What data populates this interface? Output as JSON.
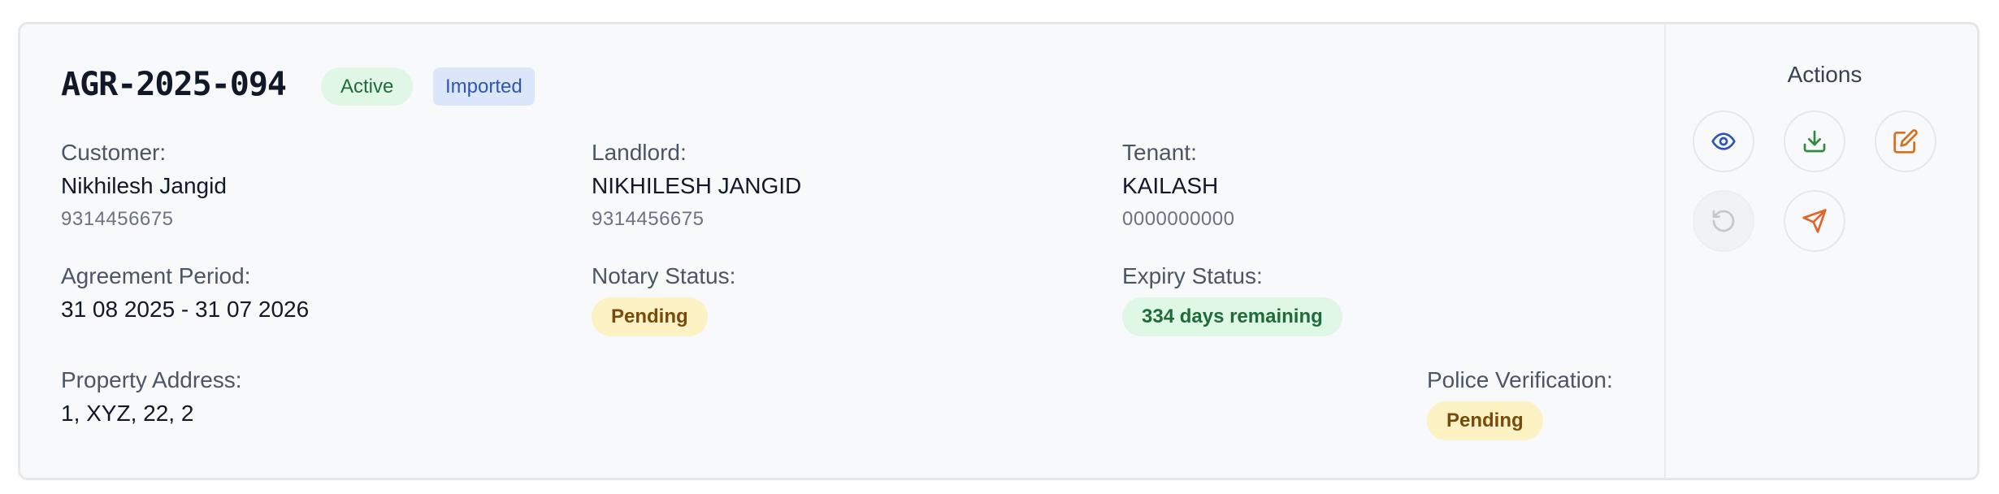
{
  "agreement": {
    "id": "AGR-2025-094",
    "status_badge": "Active",
    "source_badge": "Imported"
  },
  "customer": {
    "label": "Customer:",
    "name": "Nikhilesh Jangid",
    "phone": "9314456675"
  },
  "landlord": {
    "label": "Landlord:",
    "name": "NIKHILESH JANGID",
    "phone": "9314456675"
  },
  "tenant": {
    "label": "Tenant:",
    "name": "KAILASH",
    "phone": "0000000000"
  },
  "period": {
    "label": "Agreement Period:",
    "value": "31 08 2025 - 31 07 2026"
  },
  "notary": {
    "label": "Notary Status:",
    "value": "Pending"
  },
  "expiry": {
    "label": "Expiry Status:",
    "value": "334 days remaining"
  },
  "address": {
    "label": "Property Address:",
    "value": "1, XYZ, 22, 2"
  },
  "police": {
    "label": "Police Verification:",
    "value": "Pending"
  },
  "actions": {
    "title": "Actions",
    "buttons": [
      {
        "icon": "eye-icon",
        "color": "#2e56b4"
      },
      {
        "icon": "download-icon",
        "color": "#2f8a3e"
      },
      {
        "icon": "edit-icon",
        "color": "#d5701b"
      },
      {
        "icon": "undo-icon",
        "color": "#c4c7cc",
        "disabled": true
      },
      {
        "icon": "send-icon",
        "color": "#e2632a"
      }
    ]
  }
}
